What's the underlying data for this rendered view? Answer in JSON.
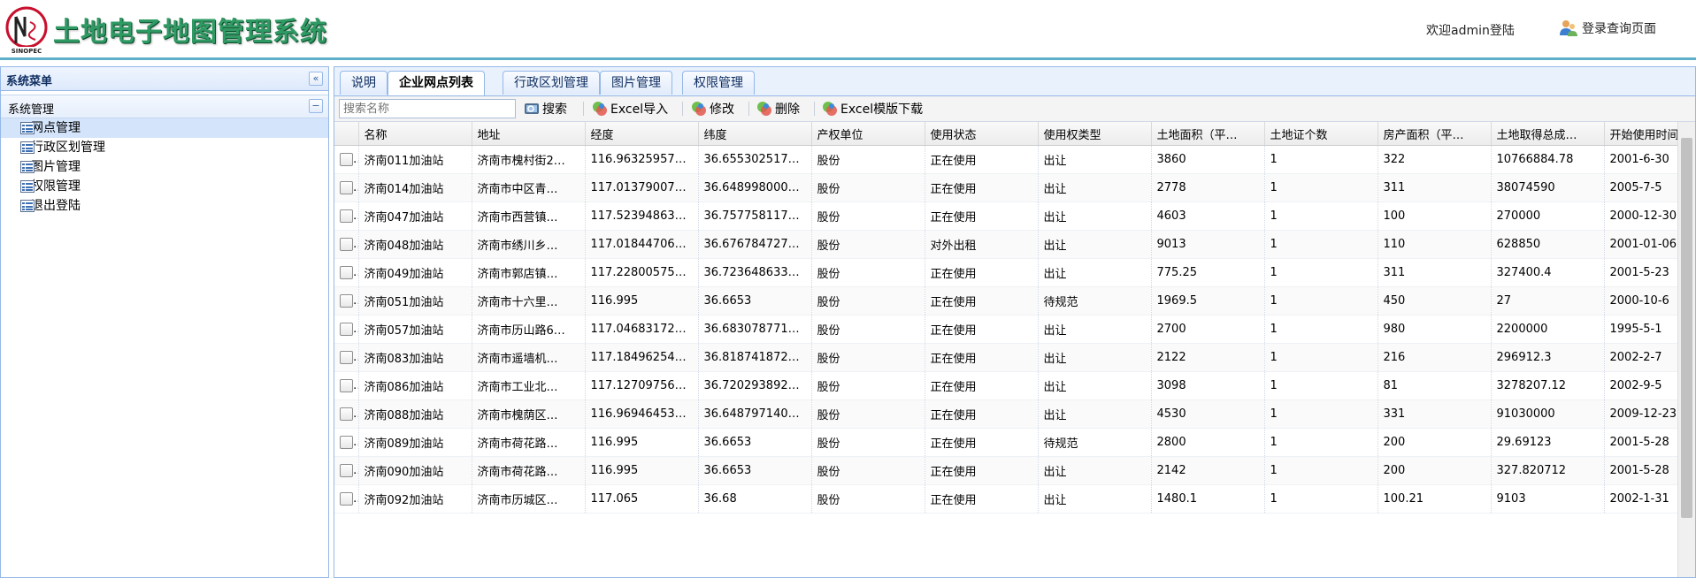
{
  "header": {
    "app_title": "土地电子地图管理系统",
    "welcome": "欢迎admin登陆",
    "login_query_label": "登录查询页面",
    "accent_color": "#2f9a63"
  },
  "sidebar": {
    "title": "系统菜单",
    "collapse_icon": "«",
    "group_title": "系统管理",
    "group_toggle_icon": "−",
    "items": [
      {
        "label": "网点管理"
      },
      {
        "label": "行政区划管理"
      },
      {
        "label": "图片管理"
      },
      {
        "label": "权限管理"
      },
      {
        "label": "退出登陆"
      }
    ]
  },
  "tabs": [
    {
      "label": "说明"
    },
    {
      "label": "企业网点列表"
    },
    {
      "label": "行政区划管理"
    },
    {
      "label": "图片管理"
    },
    {
      "label": "权限管理"
    }
  ],
  "toolbar": {
    "search_placeholder": "搜索名称",
    "search_label": "搜索",
    "import_label": "Excel导入",
    "edit_label": "修改",
    "delete_label": "删除",
    "template_label": "Excel模版下载"
  },
  "grid": {
    "columns": [
      "名称",
      "地址",
      "经度",
      "纬度",
      "产权单位",
      "使用状态",
      "使用权类型",
      "土地面积（平…",
      "土地证个数",
      "房产面积（平…",
      "土地取得总成…",
      "开始使用时间"
    ],
    "rows": [
      [
        "济南011加油站",
        "济南市槐村街2…",
        "116.96325957…",
        "36.655302517…",
        "股份",
        "正在使用",
        "出让",
        "3860",
        "1",
        "322",
        "10766884.78",
        "2001-6-30"
      ],
      [
        "济南014加油站",
        "济南市中区青…",
        "117.01379007…",
        "36.648998000…",
        "股份",
        "正在使用",
        "出让",
        "2778",
        "1",
        "311",
        "38074590",
        "2005-7-5"
      ],
      [
        "济南047加油站",
        "济南市西营镇…",
        "117.52394863…",
        "36.757758117…",
        "股份",
        "正在使用",
        "出让",
        "4603",
        "1",
        "100",
        "270000",
        "2000-12-30"
      ],
      [
        "济南048加油站",
        "济南市绣川乡…",
        "117.01844706…",
        "36.676784727…",
        "股份",
        "对外出租",
        "出让",
        "9013",
        "1",
        "110",
        "628850",
        "2001-01-06"
      ],
      [
        "济南049加油站",
        "济南市郭店镇…",
        "117.22800575…",
        "36.723648633…",
        "股份",
        "正在使用",
        "出让",
        "775.25",
        "1",
        "311",
        "327400.4",
        "2001-5-23"
      ],
      [
        "济南051加油站",
        "济南市十六里…",
        "116.995",
        "36.6653",
        "股份",
        "正在使用",
        "待规范",
        "1969.5",
        "1",
        "450",
        "27",
        "2000-10-6"
      ],
      [
        "济南057加油站",
        "济南市历山路6…",
        "117.04683172…",
        "36.683078771…",
        "股份",
        "正在使用",
        "出让",
        "2700",
        "1",
        "980",
        "2200000",
        "1995-5-1"
      ],
      [
        "济南083加油站",
        "济南市遥墙机…",
        "117.18496254…",
        "36.818741872…",
        "股份",
        "正在使用",
        "出让",
        "2122",
        "1",
        "216",
        "296912.3",
        "2002-2-7"
      ],
      [
        "济南086加油站",
        "济南市工业北…",
        "117.12709756…",
        "36.720293892…",
        "股份",
        "正在使用",
        "出让",
        "3098",
        "1",
        "81",
        "3278207.12",
        "2002-9-5"
      ],
      [
        "济南088加油站",
        "济南市槐荫区…",
        "116.96946453…",
        "36.648797140…",
        "股份",
        "正在使用",
        "出让",
        "4530",
        "1",
        "331",
        "91030000",
        "2009-12-23"
      ],
      [
        "济南089加油站",
        "济南市荷花路…",
        "116.995",
        "36.6653",
        "股份",
        "正在使用",
        "待规范",
        "2800",
        "1",
        "200",
        "29.69123",
        "2001-5-28"
      ],
      [
        "济南090加油站",
        "济南市荷花路…",
        "116.995",
        "36.6653",
        "股份",
        "正在使用",
        "出让",
        "2142",
        "1",
        "200",
        "327.820712",
        "2001-5-28"
      ],
      [
        "济南092加油站",
        "济南市历城区…",
        "117.065",
        "36.68",
        "股份",
        "正在使用",
        "出让",
        "1480.1",
        "1",
        "100.21",
        "9103",
        "2002-1-31"
      ]
    ]
  }
}
